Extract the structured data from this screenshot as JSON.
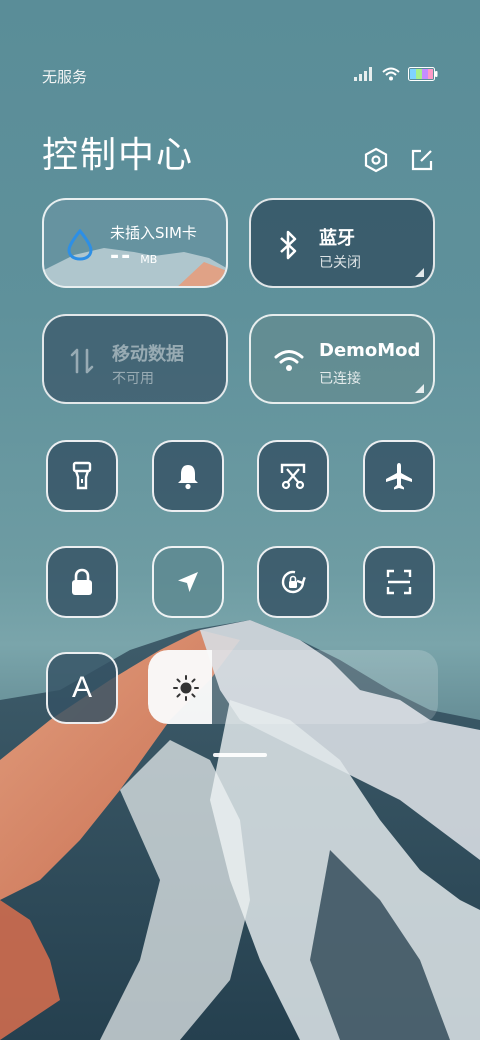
{
  "status_bar": {
    "carrier": "无服务",
    "icons": [
      "signal-icon",
      "wifi-icon",
      "battery-icon"
    ]
  },
  "header": {
    "title": "控制中心",
    "buttons": [
      "settings-icon",
      "edit-icon"
    ]
  },
  "tiles": {
    "sim": {
      "title": "未插入SIM卡",
      "value": "--",
      "unit": "MB"
    },
    "bluetooth": {
      "title": "蓝牙",
      "status": "已关闭"
    },
    "mobile_data": {
      "title": "移动数据",
      "status": "不可用"
    },
    "wifi": {
      "title": "DemoMod",
      "status": "已连接"
    }
  },
  "toggles": [
    {
      "name": "flashlight-icon",
      "active": false
    },
    {
      "name": "bell-icon",
      "active": false
    },
    {
      "name": "screenshot-icon",
      "active": false
    },
    {
      "name": "airplane-icon",
      "active": false
    },
    {
      "name": "lock-icon",
      "active": false
    },
    {
      "name": "location-icon",
      "active": true
    },
    {
      "name": "rotation-lock-icon",
      "active": false
    },
    {
      "name": "scan-icon",
      "active": false
    }
  ],
  "font_button": {
    "label": "A"
  },
  "brightness": {
    "level_percent": 22
  },
  "colors": {
    "tile_bg": "#325062",
    "accent_blue": "#2d8fe6",
    "active_toggle": "#5c8890"
  }
}
